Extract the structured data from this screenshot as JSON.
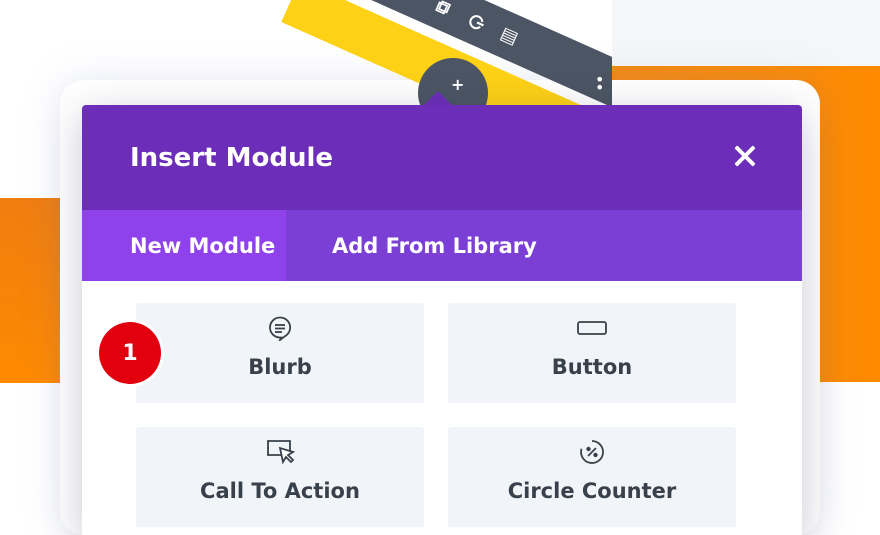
{
  "modal": {
    "title": "Insert Module",
    "close_icon": "close-icon"
  },
  "tabs": [
    {
      "label": "New Module",
      "active": true
    },
    {
      "label": "Add From Library",
      "active": false
    }
  ],
  "modules": [
    {
      "label": "Blurb",
      "icon": "speech-bubble-icon"
    },
    {
      "label": "Button",
      "icon": "button-rectangle-icon"
    },
    {
      "label": "Call To Action",
      "icon": "cursor-click-icon"
    },
    {
      "label": "Circle Counter",
      "icon": "percent-circle-icon"
    }
  ],
  "step_badge": "1",
  "colors": {
    "header": "#6c2eb9",
    "tabs_bar": "#7b3fd6",
    "active_tab": "#8f42ec",
    "accent_orange": "#ff8a00",
    "badge_red": "#e2000f"
  }
}
